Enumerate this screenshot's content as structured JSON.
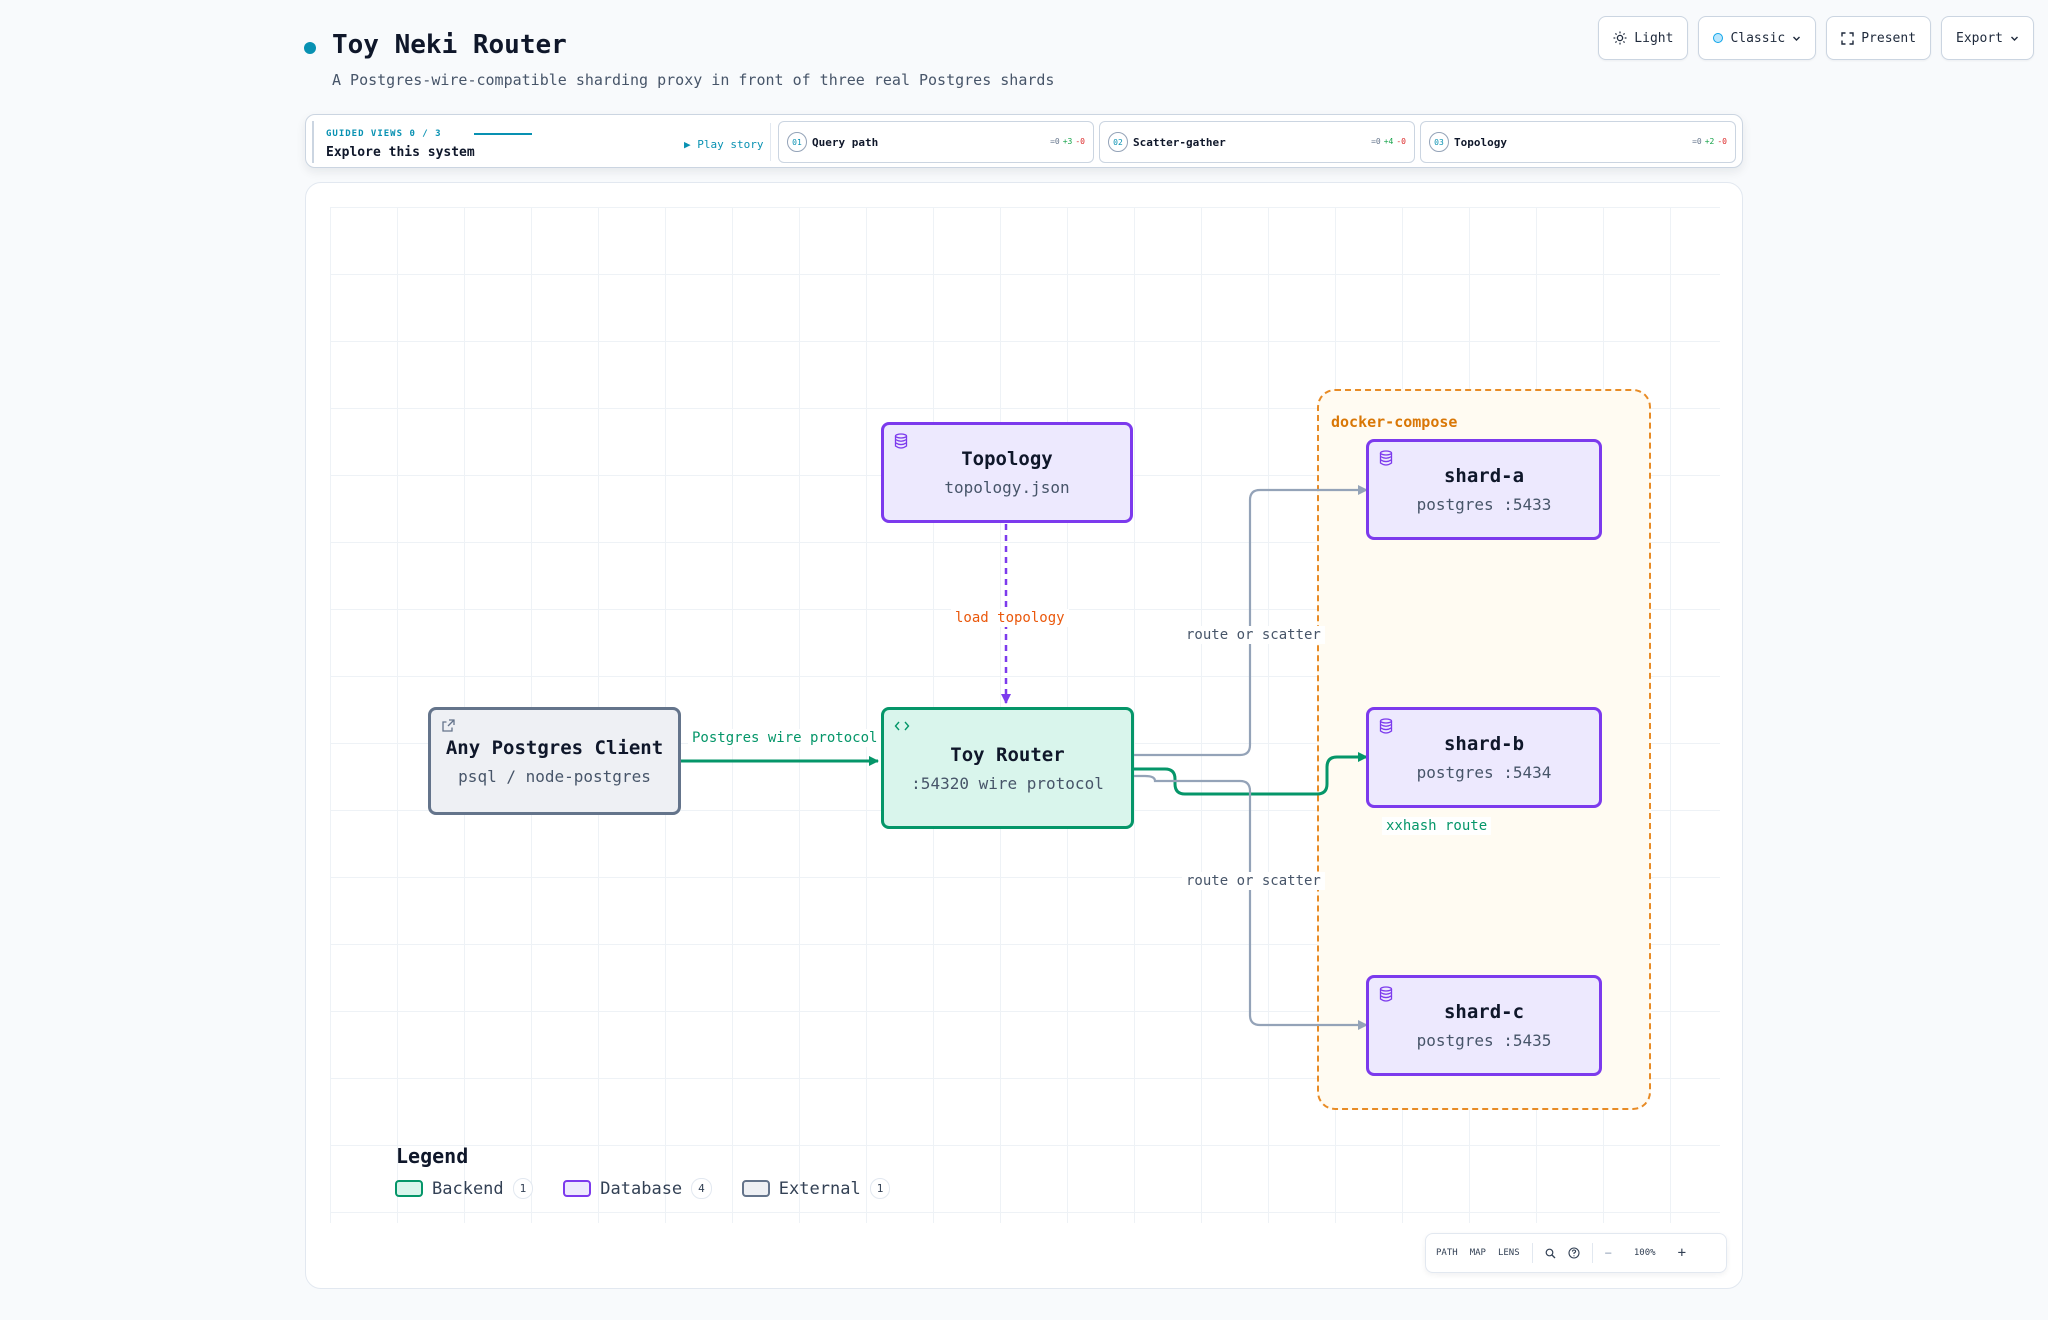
{
  "header": {
    "title": "Toy Neki Router",
    "subtitle": "A Postgres-wire-compatible sharding proxy in front of three real Postgres shards"
  },
  "top_buttons": {
    "theme": "Light",
    "style": "Classic",
    "present": "Present",
    "export": "Export"
  },
  "guided": {
    "kicker": "GUIDED VIEWS 0 / 3",
    "heading": "Explore this system",
    "play": "▶ Play story",
    "views": [
      {
        "num": "01",
        "label": "Query path",
        "eq": "=0",
        "plus": "+3",
        "minus": "-0"
      },
      {
        "num": "02",
        "label": "Scatter-gather",
        "eq": "=0",
        "plus": "+4",
        "minus": "-0"
      },
      {
        "num": "03",
        "label": "Topology",
        "eq": "=0",
        "plus": "+2",
        "minus": "-0"
      }
    ]
  },
  "diagram": {
    "group": {
      "label": "docker-compose"
    },
    "nodes": {
      "topology": {
        "title": "Topology",
        "sub": "topology.json",
        "type": "database"
      },
      "client": {
        "title": "Any Postgres Client",
        "sub": "psql / node-postgres",
        "type": "external"
      },
      "router": {
        "title": "Toy Router",
        "sub": ":54320 wire protocol",
        "type": "backend"
      },
      "shard_a": {
        "title": "shard-a",
        "sub": "postgres :5433",
        "type": "database"
      },
      "shard_b": {
        "title": "shard-b",
        "sub": "postgres :5434",
        "type": "database"
      },
      "shard_c": {
        "title": "shard-c",
        "sub": "postgres :5435",
        "type": "database"
      }
    },
    "edges": {
      "client_router": "Postgres wire protocol",
      "topology_router": "load topology",
      "router_shard_a": "route or scatter",
      "router_shard_b": "xxhash route",
      "router_shard_c": "route or scatter"
    }
  },
  "legend": {
    "title": "Legend",
    "items": [
      {
        "label": "Backend",
        "count": "1"
      },
      {
        "label": "Database",
        "count": "4"
      },
      {
        "label": "External",
        "count": "1"
      }
    ]
  },
  "toolbar": {
    "path": "PATH",
    "map": "MAP",
    "lens": "LENS",
    "minus": "−",
    "zoom": "100%",
    "plus": "+"
  },
  "colors": {
    "accent": "#0891b2",
    "backend": "#059669",
    "database": "#7c3aed",
    "external": "#64748b",
    "group": "#e88b25",
    "edge_gray": "#94a3b8",
    "load_label": "#ea580c"
  }
}
